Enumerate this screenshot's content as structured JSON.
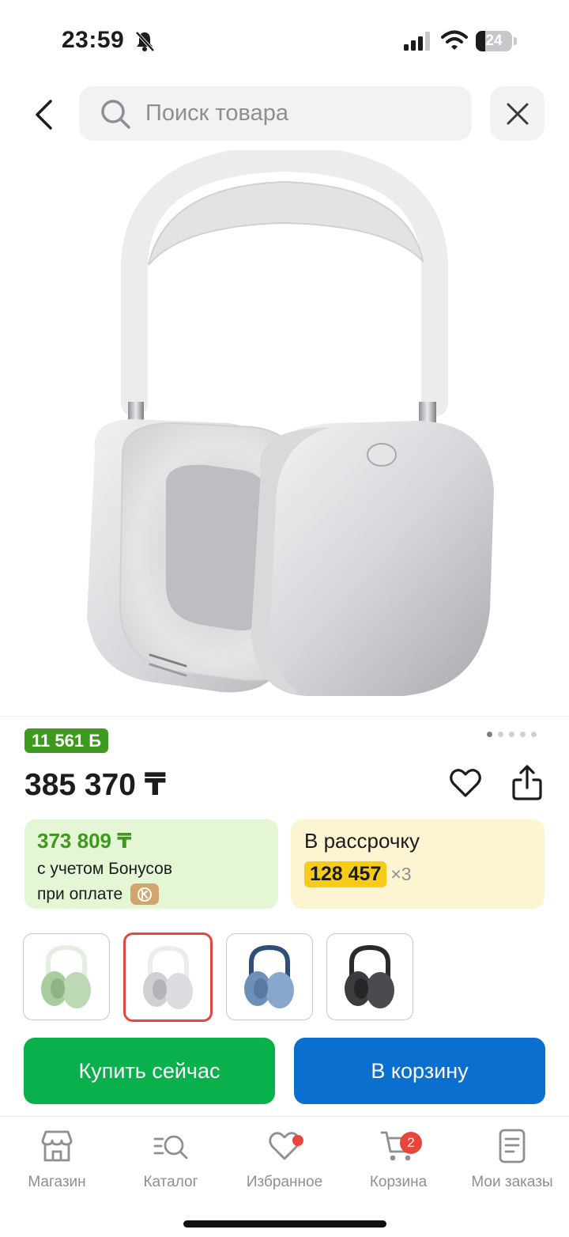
{
  "status_bar": {
    "time": "23:59",
    "battery": "24"
  },
  "search": {
    "placeholder": "Поиск товара"
  },
  "product": {
    "bonus_badge": "11 561 Б",
    "price": "385 370 ₸",
    "image_count": 5,
    "active_image": 1
  },
  "bonus_card": {
    "amount": "373 809 ₸",
    "line1": "с учетом Бонусов",
    "line2": "при оплате"
  },
  "credit_card": {
    "title": "В рассрочку",
    "monthly": "128 457",
    "multiplier": "×3"
  },
  "variants": [
    {
      "color": "green",
      "hex": "#b9d8b2",
      "selected": false
    },
    {
      "color": "silver",
      "hex": "#d9dadc",
      "selected": true
    },
    {
      "color": "sky-blue",
      "hex": "#7f9fc4",
      "selected": false
    },
    {
      "color": "space-gray",
      "hex": "#3a3b3d",
      "selected": false
    }
  ],
  "actions": {
    "buy_now": "Купить сейчас",
    "add_to_cart": "В корзину"
  },
  "tabs": [
    {
      "label": "Магазин",
      "icon": "store-icon"
    },
    {
      "label": "Каталог",
      "icon": "catalog-search-icon"
    },
    {
      "label": "Избранное",
      "icon": "heart-icon",
      "dot": true
    },
    {
      "label": "Корзина",
      "icon": "cart-icon",
      "badge": "2"
    },
    {
      "label": "Мои заказы",
      "icon": "orders-icon"
    }
  ],
  "colors": {
    "green": "#0ab04b",
    "blue": "#0a6fce",
    "bonus_green": "#3e9a1e",
    "yellow": "#f7cb18",
    "selected_border": "#e1473d"
  }
}
